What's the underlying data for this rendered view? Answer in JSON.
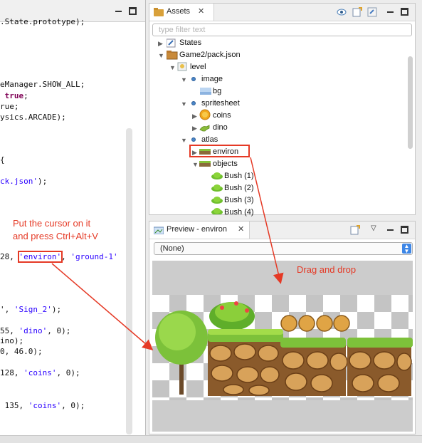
{
  "editor": {
    "lines": [
      {
        "text": ".State.prototype);"
      },
      {
        "text": "eManager.SHOW_ALL;"
      },
      {
        "pre": " ",
        "kw": "true",
        "post": ";"
      },
      {
        "pre": "rue;"
      },
      {
        "text": "ysics.ARCADE);"
      },
      {
        "text": "{"
      },
      {
        "str": "ck.json'",
        "post": ");"
      },
      {
        "pre": "28, ",
        "str": "'environ'",
        "post": ", ",
        "str2": "'ground-1'"
      },
      {
        "pre": "', ",
        "str": "'Sign_2'",
        "post": ");"
      },
      {
        "pre": "55, ",
        "str": "'dino'",
        "post": ", 0);"
      },
      {
        "text": "ino);"
      },
      {
        "text": "0, 46.0);"
      },
      {
        "pre": "128, ",
        "str": "'coins'",
        "post": ", 0);"
      },
      {
        "pre": " 135, ",
        "str": "'coins'",
        "post": ", 0);"
      }
    ]
  },
  "assets": {
    "title": "Assets",
    "filter_placeholder": "type filter text",
    "tree": {
      "states": "States",
      "pack": "Game2/pack.json",
      "level": "level",
      "image": "image",
      "bg": "bg",
      "spritesheet": "spritesheet",
      "coins": "coins",
      "dino": "dino",
      "atlas": "atlas",
      "environ": "environ",
      "objects": "objects",
      "bush1": "Bush (1)",
      "bush2": "Bush (2)",
      "bush3": "Bush (3)",
      "bush4": "Bush (4)"
    }
  },
  "preview": {
    "title": "Preview - environ",
    "select_value": "(None)"
  },
  "annotations": {
    "cursor_note_line1": "Put the cursor on it",
    "cursor_note_line2": "and press Ctrl+Alt+V",
    "drag_note": "Drag and drop"
  },
  "colors": {
    "annotation": "#e53925",
    "keyword": "#7f0055",
    "string": "#2a00ff",
    "select_accent": "#3d86e6"
  }
}
